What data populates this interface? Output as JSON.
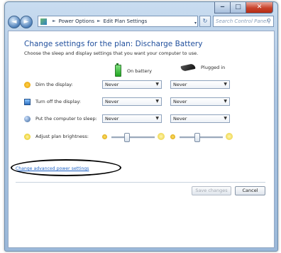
{
  "window": {
    "titlebar_buttons": {
      "minimize": "‒",
      "maximize": "□",
      "close": "✕"
    }
  },
  "nav": {
    "back_symbol": "◄",
    "forward_symbol": "►",
    "history_symbol": "▾",
    "breadcrumb": [
      "Power Options",
      "Edit Plan Settings"
    ],
    "breadcrumb_separator": "►",
    "refresh_symbol": "↻",
    "search_placeholder": "Search Control Panel",
    "search_icon": "search-icon"
  },
  "page": {
    "title": "Change settings for the plan: Discharge Battery",
    "subtitle": "Choose the sleep and display settings that you want your computer to use.",
    "columns": {
      "battery": "On battery",
      "plugged": "Plugged in"
    }
  },
  "settings": [
    {
      "label": "Dim the display:",
      "icon": "dim-display-icon",
      "battery": "Never",
      "plugged": "Never"
    },
    {
      "label": "Turn off the display:",
      "icon": "monitor-icon",
      "battery": "Never",
      "plugged": "Never"
    },
    {
      "label": "Put the computer to sleep:",
      "icon": "sleep-icon",
      "battery": "Never",
      "plugged": "Never"
    }
  ],
  "brightness": {
    "label": "Adjust plan brightness:",
    "icon": "brightness-icon",
    "battery_level": 0.35,
    "plugged_level": 0.4
  },
  "links": {
    "advanced": "Change advanced power settings"
  },
  "buttons": {
    "save": "Save changes",
    "cancel": "Cancel"
  },
  "colors": {
    "title": "#1f4e9c",
    "link": "#1a5fc4",
    "annotation": "#000000"
  }
}
